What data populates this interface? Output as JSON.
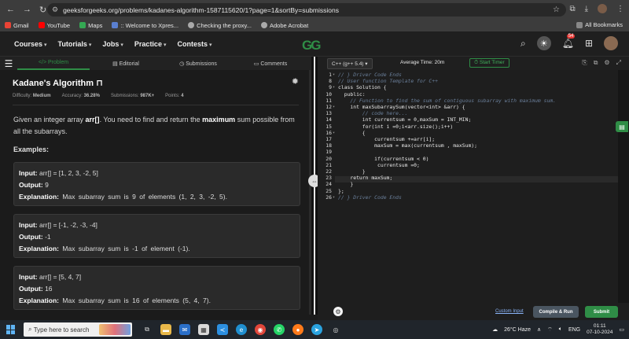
{
  "browser": {
    "url": "geeksforgeeks.org/problems/kadanes-algorithm-1587115620/1?page=1&sortBy=submissions",
    "bookmarks": [
      "Gmail",
      "YouTube",
      "Maps",
      ":: Welcome to Xpres...",
      "Checking the proxy...",
      "Adobe Acrobat"
    ],
    "all_bookmarks": "All Bookmarks"
  },
  "header": {
    "menu": [
      "Courses",
      "Tutorials",
      "Jobs",
      "Practice",
      "Contests"
    ],
    "logo": "GG",
    "notification_count": "54"
  },
  "left_tabs": [
    "Problem",
    "Editorial",
    "Submissions",
    "Comments"
  ],
  "problem": {
    "title": "Kadane's Algorithm",
    "difficulty_label": "Difficulty:",
    "difficulty": "Medium",
    "accuracy_label": "Accuracy:",
    "accuracy": "36.28%",
    "submissions_label": "Submissions:",
    "submissions": "987K+",
    "points_label": "Points:",
    "points": "4",
    "desc_1": "Given an integer array ",
    "desc_arr": "arr[]",
    "desc_2": ". You need to find and return the ",
    "desc_max": "maximum",
    "desc_3": " sum possible from all the subarrays.",
    "examples_heading": "Examples:",
    "examples": [
      {
        "input": "arr[] = [1, 2, 3, -2, 5]",
        "output": "9",
        "explanation": "Max subarray sum is 9 of elements (1, 2, 3, -2, 5)."
      },
      {
        "input": "arr[] = [-1, -2, -3, -4]",
        "output": "-1",
        "explanation": "Max subarray sum is -1 of element (-1)."
      },
      {
        "input": "arr[] = [5, 4, 7]",
        "output": "16",
        "explanation": "Max subarray sum is 16 of elements (5, 4, 7)."
      }
    ],
    "input_label": "Input:",
    "output_label": "Output:",
    "explanation_label": "Explanation:"
  },
  "editor": {
    "language": "C++ (g++ 5.4)",
    "avg_time": "Average Time: 20m",
    "timer": "Start Timer",
    "lines": [
      {
        "n": "1",
        "text": "// } Driver Code Ends"
      },
      {
        "n": "8",
        "text": "// User function Template for C++"
      },
      {
        "n": "9",
        "text": "class Solution {"
      },
      {
        "n": "10",
        "text": "  public:"
      },
      {
        "n": "11",
        "text": "    // Function to find the sum of contiguous subarray with maximum sum."
      },
      {
        "n": "12",
        "text": "    int maxSubarraySum(vector<int> &arr) {"
      },
      {
        "n": "13",
        "text": "        // code here..."
      },
      {
        "n": "14",
        "text": "        int currentsum = 0,maxSum = INT_MIN;"
      },
      {
        "n": "15",
        "text": "        for(int i =0;i<arr.size();i++)"
      },
      {
        "n": "16",
        "text": "        {"
      },
      {
        "n": "17",
        "text": "            currentsum +=arr[i];"
      },
      {
        "n": "18",
        "text": "            maxSum = max(currentsum , maxSum);"
      },
      {
        "n": "19",
        "text": ""
      },
      {
        "n": "20",
        "text": "            if(currentsum < 0)"
      },
      {
        "n": "21",
        "text": "             currentsum =0;"
      },
      {
        "n": "22",
        "text": "        }"
      },
      {
        "n": "23",
        "text": "    return maxSum;"
      },
      {
        "n": "24",
        "text": "    }"
      },
      {
        "n": "25",
        "text": "};"
      },
      {
        "n": "26",
        "text": "// } Driver Code Ends"
      }
    ],
    "custom_input": "Custom Input",
    "compile_run": "Compile & Run",
    "submit": "Submit"
  },
  "taskbar": {
    "search_placeholder": "Type here to search",
    "weather": "26°C  Haze",
    "lang": "ENG",
    "time": "01:11",
    "date": "07-10-2024"
  }
}
